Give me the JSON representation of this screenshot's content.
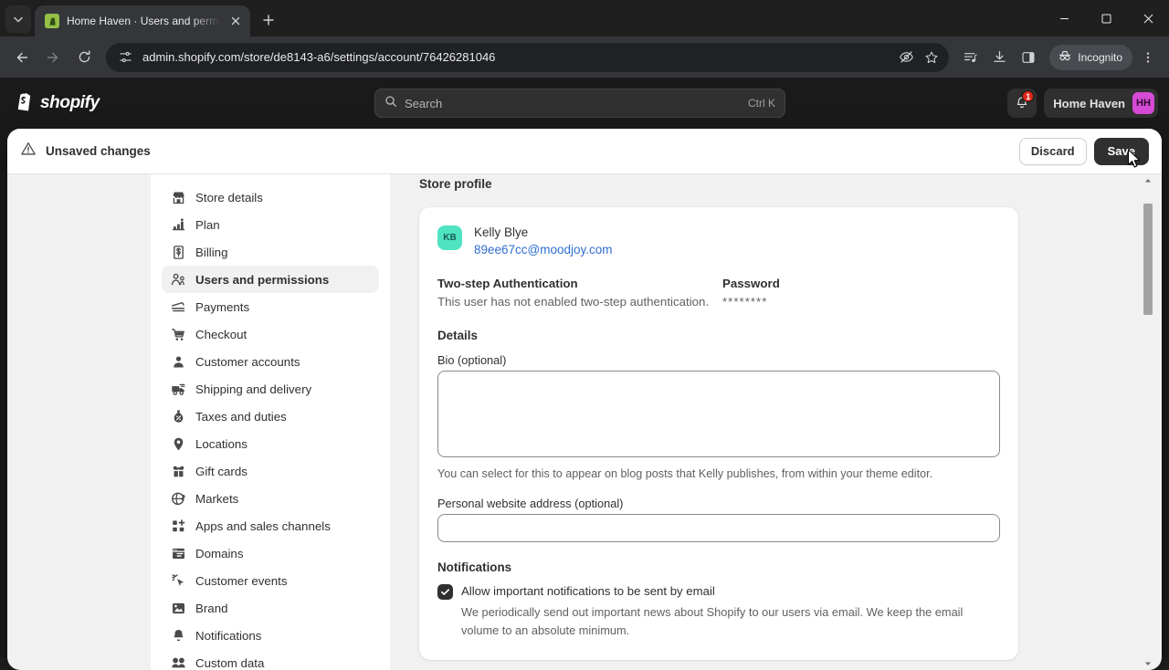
{
  "browser": {
    "tab": {
      "title": "Home Haven · Users and permi",
      "favicon_icon": "shopify-favicon",
      "close_icon": "close-icon"
    },
    "tab_list_icon": "chevron-down-icon",
    "new_tab_icon": "plus-icon",
    "window_controls": {
      "minimize_icon": "minimize-icon",
      "maximize_icon": "maximize-icon",
      "close_icon": "window-close-icon"
    },
    "toolbar": {
      "back_icon": "back-arrow-icon",
      "forward_icon": "forward-arrow-icon",
      "reload_icon": "reload-icon",
      "site_settings_icon": "page-settings-icon",
      "url": "admin.shopify.com/store/de8143-a6/settings/account/76426281046",
      "tracking_protection_icon": "eye-slash-icon",
      "bookmark_icon": "star-icon",
      "reading_list_icon": "reading-list-icon",
      "downloads_icon": "download-icon",
      "side_panel_icon": "side-panel-icon",
      "incognito_label": "Incognito",
      "incognito_icon": "incognito-icon",
      "menu_icon": "three-dot-menu-icon"
    }
  },
  "shopify_header": {
    "logo_text": "shopify",
    "logo_icon": "shopify-bag-icon",
    "search": {
      "placeholder": "Search",
      "icon": "search-icon",
      "shortcut": "Ctrl K"
    },
    "notifications": {
      "icon": "bell-icon",
      "badge_count": "1"
    },
    "store": {
      "name": "Home Haven",
      "initials": "HH",
      "avatar_color": "#d64bd6"
    }
  },
  "unsaved_bar": {
    "icon": "warning-triangle-icon",
    "message": "Unsaved changes",
    "discard_label": "Discard",
    "save_label": "Save"
  },
  "settings_nav": {
    "items": [
      {
        "label": "Store details",
        "icon": "store-icon",
        "active": false
      },
      {
        "label": "Plan",
        "icon": "chart-plan-icon",
        "active": false
      },
      {
        "label": "Billing",
        "icon": "billing-receipt-icon",
        "active": false
      },
      {
        "label": "Users and permissions",
        "icon": "users-icon",
        "active": true
      },
      {
        "label": "Payments",
        "icon": "payments-card-icon",
        "active": false
      },
      {
        "label": "Checkout",
        "icon": "cart-icon",
        "active": false
      },
      {
        "label": "Customer accounts",
        "icon": "person-icon",
        "active": false
      },
      {
        "label": "Shipping and delivery",
        "icon": "truck-icon",
        "active": false
      },
      {
        "label": "Taxes and duties",
        "icon": "tax-icon",
        "active": false
      },
      {
        "label": "Locations",
        "icon": "map-pin-icon",
        "active": false
      },
      {
        "label": "Gift cards",
        "icon": "gift-card-icon",
        "active": false
      },
      {
        "label": "Markets",
        "icon": "globe-icon",
        "active": false
      },
      {
        "label": "Apps and sales channels",
        "icon": "apps-grid-icon",
        "active": false
      },
      {
        "label": "Domains",
        "icon": "domains-icon",
        "active": false
      },
      {
        "label": "Customer events",
        "icon": "click-events-icon",
        "active": false
      },
      {
        "label": "Brand",
        "icon": "brand-image-icon",
        "active": false
      },
      {
        "label": "Notifications",
        "icon": "bell-icon",
        "active": false
      },
      {
        "label": "Custom data",
        "icon": "custom-data-icon",
        "active": false
      }
    ]
  },
  "content": {
    "title": "Store profile",
    "user": {
      "initials": "KB",
      "avatar_color": "#4fe3c1",
      "name": "Kelly Blye",
      "email": "89ee67cc@moodjoy.com"
    },
    "two_step": {
      "heading": "Two-step Authentication",
      "status": "This user has not enabled two-step authentication."
    },
    "password": {
      "heading": "Password",
      "masked": "********"
    },
    "details": {
      "heading": "Details",
      "bio_label": "Bio (optional)",
      "bio_value": "",
      "bio_help": "You can select for this to appear on blog posts that Kelly publishes, from within your theme editor.",
      "website_label": "Personal website address (optional)",
      "website_value": ""
    },
    "notifications": {
      "heading": "Notifications",
      "checkbox_checked": true,
      "checkbox_label": "Allow important notifications to be sent by email",
      "help": "We periodically send out important news about Shopify to our users via email. We keep the email volume to an absolute minimum."
    }
  }
}
